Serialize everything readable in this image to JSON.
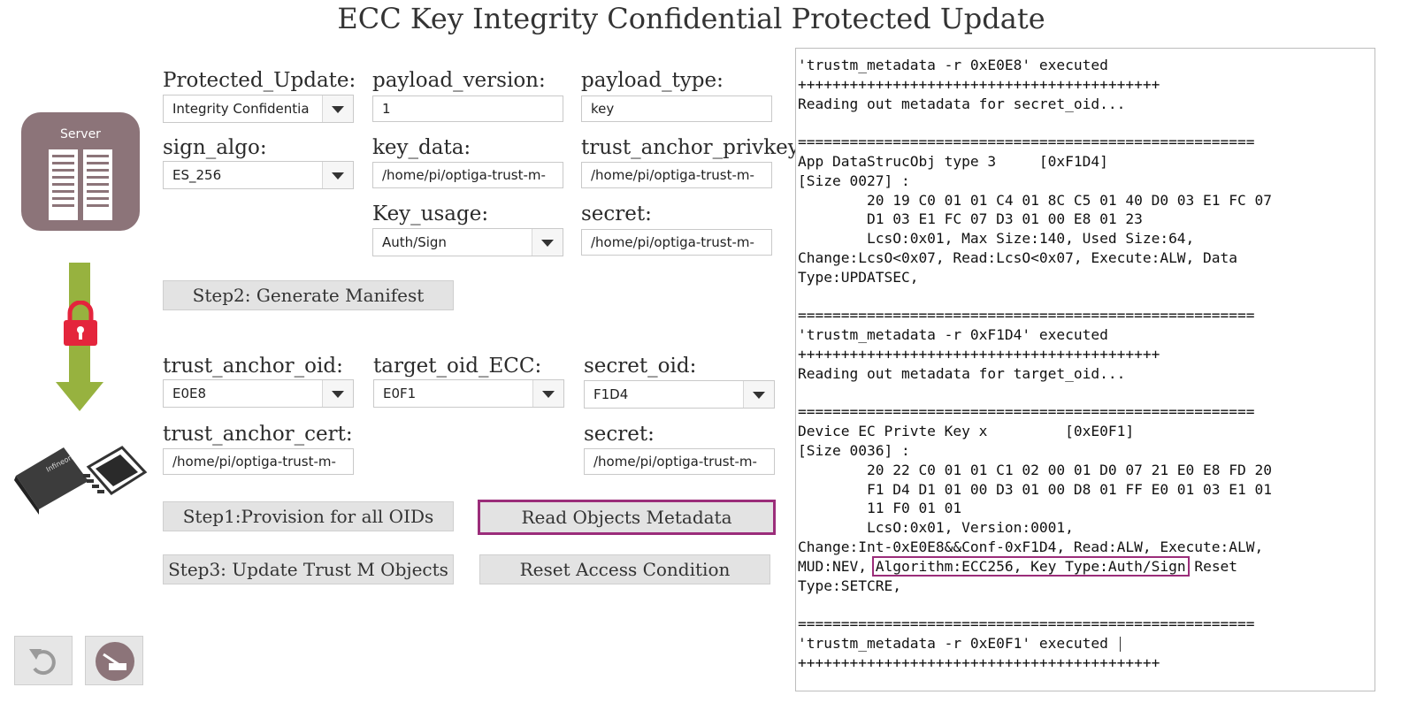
{
  "title": "ECC Key Integrity Confidential Protected Update",
  "colors": {
    "accent_highlight": "#9b2d7a",
    "server_icon": "#8c7479",
    "arrow_green": "#97b23f",
    "lock_red": "#e4253c"
  },
  "server_label": "Server",
  "form": {
    "protected_update": {
      "label": "Protected_Update:",
      "value": "Integrity Confidentia"
    },
    "payload_version": {
      "label": "payload_version:",
      "value": "1"
    },
    "payload_type": {
      "label": "payload_type:",
      "value": "key"
    },
    "sign_algo": {
      "label": "sign_algo:",
      "value": "ES_256"
    },
    "key_data": {
      "label": "key_data:",
      "value": "/home/pi/optiga-trust-m-"
    },
    "trust_anchor_privkey": {
      "label": "trust_anchor_privkey:",
      "value": "/home/pi/optiga-trust-m-"
    },
    "key_usage": {
      "label": "Key_usage:",
      "value": "Auth/Sign"
    },
    "secret_top": {
      "label": "secret:",
      "value": "/home/pi/optiga-trust-m-"
    },
    "trust_anchor_oid": {
      "label": "trust_anchor_oid:",
      "value": "E0E8"
    },
    "target_oid_ecc": {
      "label": "target_oid_ECC:",
      "value": "E0F1"
    },
    "secret_oid": {
      "label": "secret_oid:",
      "value": "F1D4"
    },
    "trust_anchor_cert": {
      "label": "trust_anchor_cert:",
      "value": "/home/pi/optiga-trust-m-"
    },
    "secret_bottom": {
      "label": "secret:",
      "value": "/home/pi/optiga-trust-m-"
    }
  },
  "buttons": {
    "step2": "Step2: Generate Manifest",
    "step1": "Step1:Provision for all OIDs",
    "read_meta": "Read Objects Metadata",
    "step3": "Step3: Update Trust M Objects",
    "reset_access": "Reset Access Condition"
  },
  "terminal": {
    "lines": [
      "'trustm_metadata -r 0xE0E8' executed",
      "++++++++++++++++++++++++++++++++++++++++++",
      "Reading out metadata for secret_oid...",
      "",
      "=====================================================",
      "App DataStrucObj type 3     [0xF1D4]",
      "[Size 0027] :",
      "        20 19 C0 01 01 C4 01 8C C5 01 40 D0 03 E1 FC 07",
      "        D1 03 E1 FC 07 D3 01 00 E8 01 23",
      "        LcsO:0x01, Max Size:140, Used Size:64,",
      "Change:LcsO<0x07, Read:LcsO<0x07, Execute:ALW, Data",
      "Type:UPDATSEC,",
      "",
      "=====================================================",
      "'trustm_metadata -r 0xF1D4' executed",
      "++++++++++++++++++++++++++++++++++++++++++",
      "Reading out metadata for target_oid...",
      "",
      "=====================================================",
      "Device EC Privte Key x         [0xE0F1]",
      "[Size 0036] :",
      "        20 22 C0 01 01 C1 02 00 01 D0 07 21 E0 E8 FD 20",
      "        F1 D4 D1 01 00 D3 01 00 D8 01 FF E0 01 03 E1 01",
      "        11 F0 01 01",
      "        LcsO:0x01, Version:0001,",
      "Change:Int-0xE0E8&&Conf-0xF1D4, Read:ALW, Execute:ALW,"
    ],
    "mud_prefix": "MUD:NEV, ",
    "mud_highlight": "Algorithm:ECC256, Key Type:Auth/Sign",
    "mud_suffix": " Reset",
    "after_lines": [
      "Type:SETCRE,",
      "",
      "=====================================================",
      "'trustm_metadata -r 0xE0F1' executed "
    ],
    "last_line": "++++++++++++++++++++++++++++++++++++++++++"
  }
}
